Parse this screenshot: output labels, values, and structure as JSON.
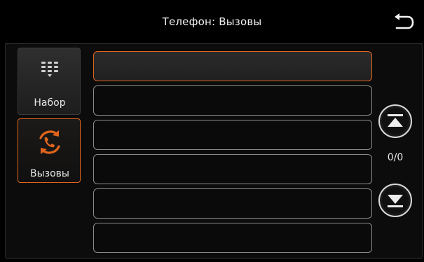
{
  "header": {
    "title": "Телефон: Вызовы",
    "back_icon": "back-arrow-icon"
  },
  "sidebar": {
    "items": [
      {
        "label": "Набор",
        "icon": "dialpad-icon",
        "active": false
      },
      {
        "label": "Вызовы",
        "icon": "call-history-icon",
        "active": true
      }
    ]
  },
  "call_list": {
    "rows": [
      {
        "text": "",
        "selected": true
      },
      {
        "text": "",
        "selected": false
      },
      {
        "text": "",
        "selected": false
      },
      {
        "text": "",
        "selected": false
      },
      {
        "text": "",
        "selected": false
      },
      {
        "text": "",
        "selected": false
      }
    ]
  },
  "pager": {
    "counter": "0/0",
    "up_icon": "scroll-up-icon",
    "down_icon": "scroll-down-icon"
  },
  "colors": {
    "accent": "#e0651b",
    "background": "#000000",
    "row_border": "#8c8c8c"
  }
}
